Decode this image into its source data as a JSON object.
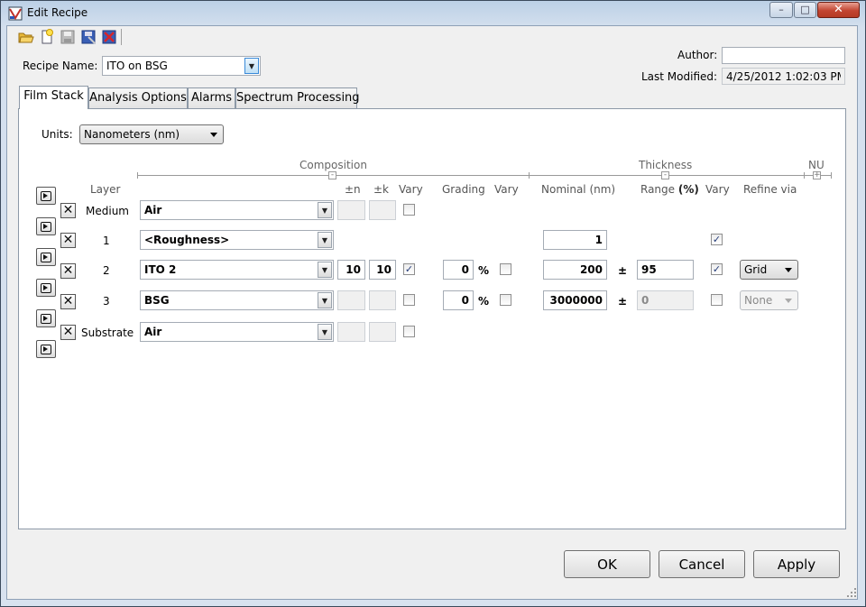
{
  "window": {
    "title": "Edit Recipe",
    "controls": {
      "minimize": "–",
      "maximize": "□",
      "close": "✕"
    }
  },
  "toolbar": {
    "icons": [
      "open-folder-icon",
      "new-file-icon",
      "save-icon",
      "save-as-icon",
      "delete-icon"
    ]
  },
  "recipe": {
    "label": "Recipe Name:",
    "value": "ITO on BSG"
  },
  "author": {
    "label": "Author:",
    "value": ""
  },
  "last_modified": {
    "label": "Last Modified:",
    "value": "4/25/2012 1:02:03 PM"
  },
  "tabs": [
    {
      "label": "Film Stack",
      "active": true
    },
    {
      "label": "Analysis Options"
    },
    {
      "label": "Alarms"
    },
    {
      "label": "Spectrum Processing"
    }
  ],
  "units": {
    "label": "Units:",
    "value": "Nanometers (nm)"
  },
  "groups": {
    "composition": "Composition",
    "thickness": "Thickness",
    "nu": "NU"
  },
  "headers": {
    "layer": "Layer",
    "n": "±n",
    "k": "±k",
    "vary": "Vary",
    "grading": "Grading",
    "vary2": "Vary",
    "nominal": "Nominal (nm)",
    "range": "Range",
    "range_pct": "(%)",
    "vary3": "Vary",
    "refine": "Refine via"
  },
  "symbols": {
    "percent": "%",
    "plusminus": "±",
    "check": "✓",
    "remove": "✕"
  },
  "layers": {
    "medium": {
      "name": "Medium",
      "material": "Air",
      "n": "",
      "k": "",
      "vary": false
    },
    "l1": {
      "name": "1",
      "material": "<Roughness>",
      "nominal": "1",
      "thick_vary": true
    },
    "l2": {
      "name": "2",
      "material": "ITO 2",
      "n": "10",
      "k": "10",
      "vary": true,
      "grading": "0",
      "grading_vary": false,
      "nominal": "200",
      "range": "95",
      "thick_vary": true,
      "refine": "Grid"
    },
    "l3": {
      "name": "3",
      "material": "BSG",
      "n": "",
      "k": "",
      "vary": false,
      "grading": "0",
      "grading_vary": false,
      "nominal": "3000000",
      "range": "0",
      "thick_vary": false,
      "refine": "None"
    },
    "substrate": {
      "name": "Substrate",
      "material": "Air",
      "n": "",
      "k": "",
      "vary": false
    }
  },
  "buttons": {
    "ok": "OK",
    "cancel": "Cancel",
    "apply": "Apply"
  }
}
